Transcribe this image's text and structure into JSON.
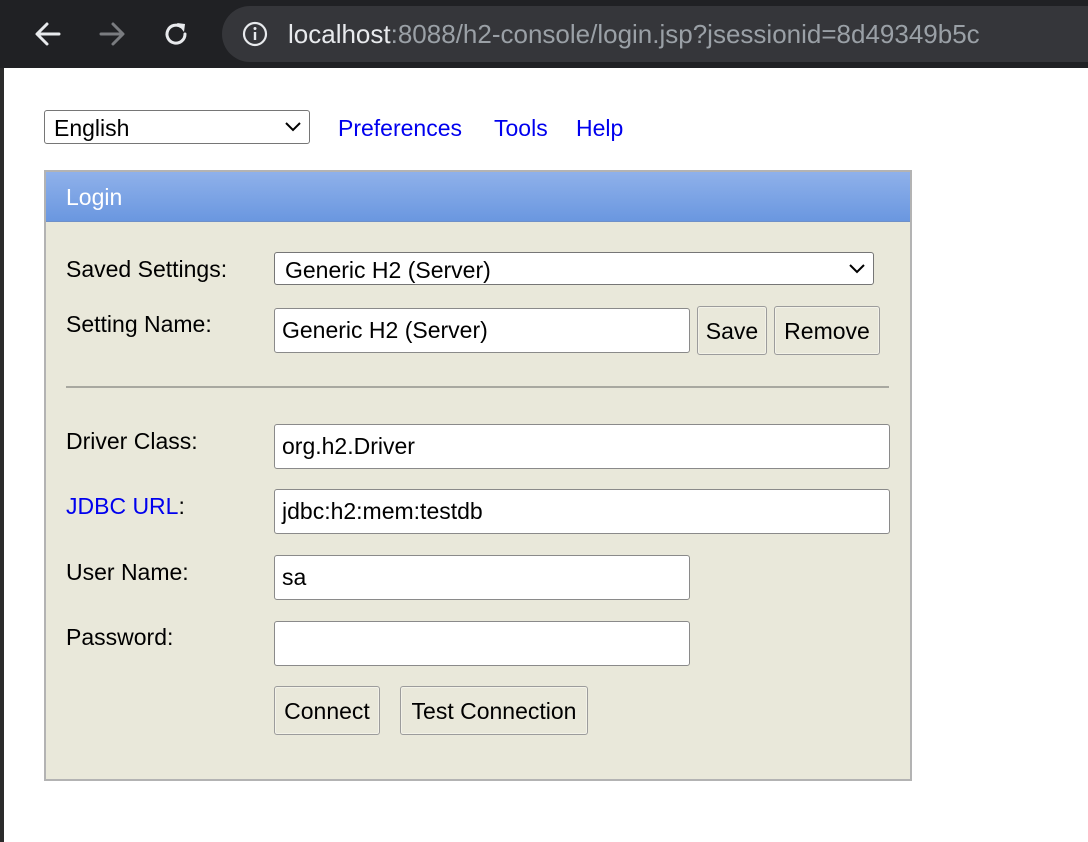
{
  "browser": {
    "url_host": "localhost",
    "url_rest": ":8088/h2-console/login.jsp?jsessionid=8d49349b5c"
  },
  "top_nav": {
    "language": "English",
    "links": [
      "Preferences",
      "Tools",
      "Help"
    ]
  },
  "login": {
    "title": "Login",
    "saved_settings_label": "Saved Settings:",
    "saved_settings_value": "Generic H2 (Server)",
    "setting_name_label": "Setting Name:",
    "setting_name_value": "Generic H2 (Server)",
    "save_button": "Save",
    "remove_button": "Remove",
    "driver_class_label": "Driver Class:",
    "driver_class_value": "org.h2.Driver",
    "jdbc_url_link": "JDBC URL",
    "jdbc_url_colon": ":",
    "jdbc_url_value": "jdbc:h2:mem:testdb",
    "user_name_label": "User Name:",
    "user_name_value": "sa",
    "password_label": "Password:",
    "password_value": "",
    "connect_button": "Connect",
    "test_connection_button": "Test Connection"
  },
  "colors": {
    "panel_background": "#e9e8da",
    "header_gradient_top": "#8fb1ea",
    "header_gradient_bottom": "#6a97e0",
    "link": "#0000ee"
  }
}
